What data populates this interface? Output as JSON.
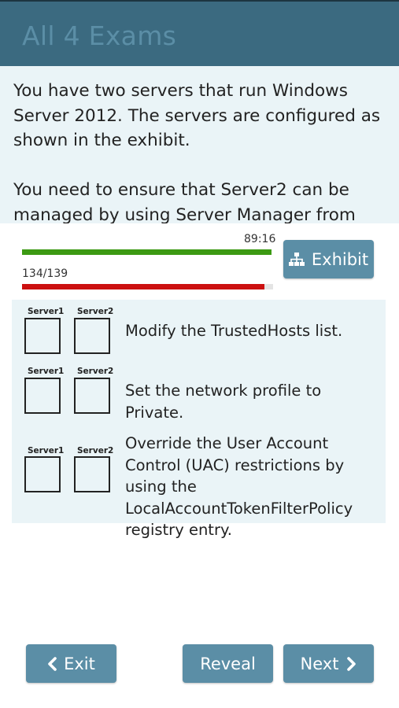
{
  "header": {
    "title": "All 4 Exams"
  },
  "question": {
    "paragraphs": [
      "You have two servers that run Windows Server 2012. The servers are configured as shown in the exhibit.",
      "You need to ensure that Server2 can be managed by using Server Manager from"
    ]
  },
  "timer": {
    "label": "89:16",
    "fraction_remaining": 1.0,
    "color": "#3c9a13"
  },
  "progress": {
    "label": "134/139",
    "current": 134,
    "total": 139,
    "color": "#cc1010"
  },
  "exhibit_button": {
    "label": "Exhibit",
    "icon": "sitemap-icon"
  },
  "answers": {
    "column_labels": [
      "Server1",
      "Server2"
    ],
    "rows": [
      {
        "text": "Modify the TrustedHosts list.",
        "server1_checked": false,
        "server2_checked": false
      },
      {
        "text": "Set the network profile to Private.",
        "server1_checked": false,
        "server2_checked": false
      },
      {
        "text": "Override the User Account Control (UAC) restrictions by using the LocalAccountTokenFilterPolicy registry entry.",
        "server1_checked": false,
        "server2_checked": false
      }
    ]
  },
  "footer": {
    "exit_label": "Exit",
    "reveal_label": "Reveal",
    "next_label": "Next"
  },
  "colors": {
    "header_bg": "#3b6a80",
    "header_text": "#5b8ea6",
    "panel_bg": "#eaf4f7",
    "button_bg": "#5b8ea6"
  }
}
